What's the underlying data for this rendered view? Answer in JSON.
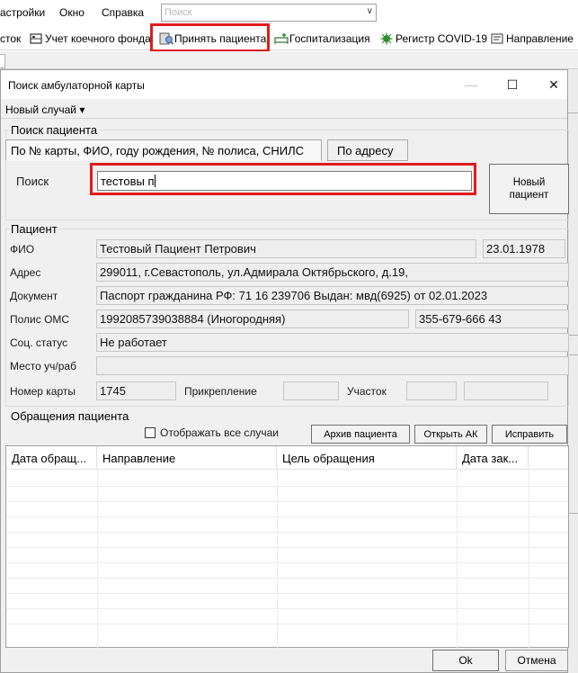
{
  "menubar": {
    "items": [
      "астройки",
      "Окно",
      "Справка"
    ],
    "search_placeholder": "Поиск"
  },
  "toolbar": {
    "items": [
      {
        "label": "сток",
        "icon": "folder-icon"
      },
      {
        "label": "Учет коечного фонда",
        "icon": "bed-icon"
      },
      {
        "label": "Принять пациента",
        "icon": "accept-patient-icon"
      },
      {
        "label": "Госпитализация",
        "icon": "hospitalization-icon"
      },
      {
        "label": "Регистр COVID-19",
        "icon": "covid-icon"
      },
      {
        "label": "Направление",
        "icon": "referral-icon"
      }
    ],
    "highlight_color": "#e11c1c"
  },
  "dialog": {
    "title": "Поиск амбулаторной карты",
    "controls": {
      "minimize": "—",
      "maximize": "☐",
      "close": "✕"
    },
    "new_case_menu": "Новый случай ▾"
  },
  "search_group": {
    "title": "Поиск пациента",
    "tabs": [
      "По № карты, ФИО, году рождения, № полиса, СНИЛС",
      "По адресу"
    ],
    "search_label": "Поиск",
    "search_value": "тестовы п",
    "new_patient_button": "Новый пациент"
  },
  "patient_group": {
    "title": "Пациент",
    "fio_label": "ФИО",
    "fio": "Тестовый Пациент Петрович",
    "birth_date": "23.01.1978",
    "address_label": "Адрес",
    "address": "299011, г.Севастополь, ул.Адмирала Октябрьского, д.19,",
    "document_label": "Документ",
    "document": "Паспорт гражданина РФ: 71 16 239706 Выдан: мвд(6925) от 02.01.2023",
    "oms_label": "Полис ОМС",
    "oms": "1992085739038884 (Иногородняя)",
    "snils": "355-679-666 43",
    "social_label": "Соц. статус",
    "social": "Не работает",
    "workplace_label": "Место уч/раб",
    "workplace": "",
    "card_label": "Номер карты",
    "card": "1745",
    "attachment_label": "Прикрепление",
    "attachment": "",
    "district_label": "Участок",
    "district": "",
    "district_extra": ""
  },
  "visits_group": {
    "title": "Обращения пациента",
    "show_all_label": "Отображать все случаи",
    "show_all_checked": false,
    "buttons": {
      "archive": "Архив пациента",
      "open_ak": "Открыть АК",
      "fix": "Исправить"
    },
    "columns": [
      "Дата обращ...",
      "Направление",
      "Цель обращения",
      "Дата зак..."
    ],
    "rows": []
  },
  "footer": {
    "ok": "Ok",
    "cancel": "Отмена"
  }
}
